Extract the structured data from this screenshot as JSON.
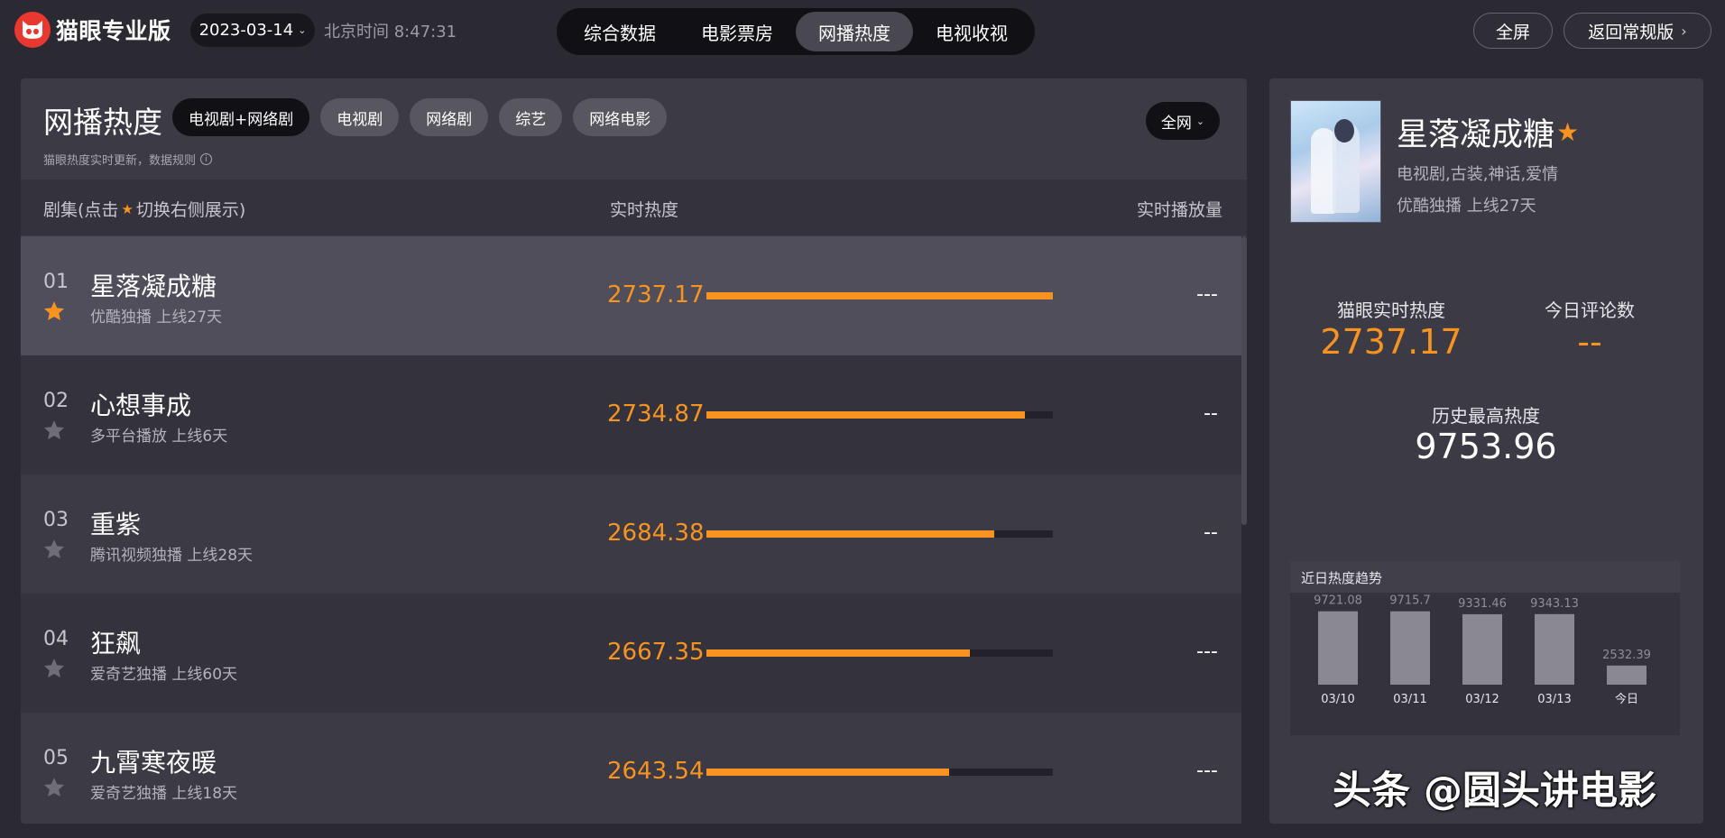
{
  "header": {
    "brand": "猫眼专业版",
    "date": "2023-03-14",
    "clock": "北京时间 8:47:31",
    "nav_tabs": [
      {
        "label": "综合数据",
        "active": false
      },
      {
        "label": "电影票房",
        "active": false
      },
      {
        "label": "网播热度",
        "active": true
      },
      {
        "label": "电视收视",
        "active": false
      }
    ],
    "fullscreen_label": "全屏",
    "back_label": "返回常规版"
  },
  "main": {
    "title": "网播热度",
    "chips": [
      {
        "label": "电视剧+网络剧",
        "active": true
      },
      {
        "label": "电视剧",
        "active": false
      },
      {
        "label": "网络剧",
        "active": false
      },
      {
        "label": "综艺",
        "active": false
      },
      {
        "label": "网络电影",
        "active": false
      }
    ],
    "scope": "全网",
    "note": "猫眼热度实时更新，数据规则",
    "columns": {
      "name_prefix": "剧集(点击",
      "name_suffix": "切换右侧展示)",
      "heat": "实时热度",
      "plays": "实时播放量"
    },
    "rows": [
      {
        "rank": "01",
        "name": "星落凝成糖",
        "sub": "优酷独播  上线27天",
        "heat": "2737.17",
        "bar": 1.0,
        "plays": "---",
        "starred": true
      },
      {
        "rank": "02",
        "name": "心想事成",
        "sub": "多平台播放  上线6天",
        "heat": "2734.87",
        "bar": 0.92,
        "plays": "--",
        "starred": false
      },
      {
        "rank": "03",
        "name": "重紫",
        "sub": "腾讯视频独播  上线28天",
        "heat": "2684.38",
        "bar": 0.83,
        "plays": "--",
        "starred": false
      },
      {
        "rank": "04",
        "name": "狂飙",
        "sub": "爱奇艺独播  上线60天",
        "heat": "2667.35",
        "bar": 0.76,
        "plays": "---",
        "starred": false
      },
      {
        "rank": "05",
        "name": "九霄寒夜暖",
        "sub": "爱奇艺独播  上线18天",
        "heat": "2643.54",
        "bar": 0.7,
        "plays": "---",
        "starred": false
      }
    ]
  },
  "detail": {
    "title": "星落凝成糖",
    "genre": "电视剧,古装,神话,爱情",
    "info": "优酷独播  上线27天",
    "stats": {
      "realtime_label": "猫眼实时热度",
      "realtime_value": "2737.17",
      "comments_label": "今日评论数",
      "comments_value": "--",
      "peak_label": "历史最高热度",
      "peak_value": "9753.96"
    },
    "trend_title": "近日热度趋势"
  },
  "chart_data": {
    "type": "bar",
    "title": "近日热度趋势",
    "categories": [
      "03/10",
      "03/11",
      "03/12",
      "03/13",
      "今日"
    ],
    "values": [
      9721.08,
      9715.7,
      9331.46,
      9343.13,
      2532.39
    ],
    "value_labels": [
      "9721.08",
      "9715.7",
      "9331.46",
      "9343.13",
      "2532.39"
    ],
    "bar_color": "#8a8993",
    "ylim": [
      0,
      9800
    ]
  },
  "watermark": "头条 @圆头讲电影",
  "colors": {
    "accent": "#f7931e",
    "background": "#2b2a33",
    "panel": "#3b3a45"
  }
}
